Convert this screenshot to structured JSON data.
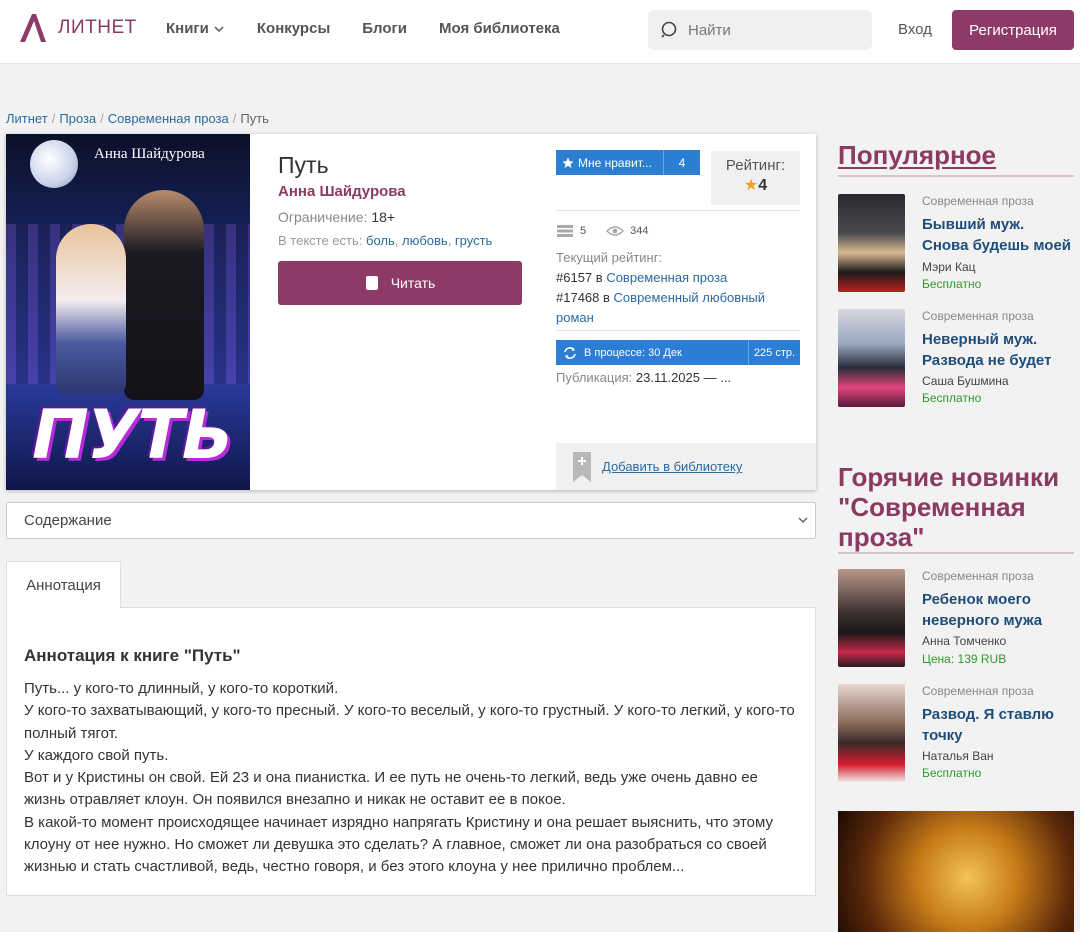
{
  "header": {
    "logo_text": "ЛИТНЕТ",
    "nav": [
      "Книги",
      "Конкурсы",
      "Блоги",
      "Моя библиотека"
    ],
    "search_placeholder": "Найти",
    "login": "Вход",
    "register": "Регистрация"
  },
  "breadcrumb": [
    "Литнет",
    "Проза",
    "Современная проза",
    "Путь"
  ],
  "book": {
    "cover_author": "Анна Шайдурова",
    "cover_title": "ПУТЬ",
    "title": "Путь",
    "author": "Анна Шайдурова",
    "restriction_label": "Ограничение:",
    "restriction_value": "18+",
    "tags_label": "В тексте есть:",
    "tags": [
      "боль",
      "любовь",
      "грусть"
    ],
    "read_button": "Читать",
    "like_label": "Мне нравит...",
    "like_count": "4",
    "rating_label": "Рейтинг:",
    "rating_value": "4",
    "library_count": "5",
    "views_count": "344",
    "current_rating_label": "Текущий рейтинг:",
    "rank1_num": "#6157",
    "rank1_genre": "Современная проза",
    "rank2_num": "#17468",
    "rank2_genre": "Современный любовный роман",
    "in_word": "в",
    "status": "В процессе: 30 Дек",
    "pages": "225 стр.",
    "publication_label": "Публикация:",
    "publication_value": "23.11.2025 — ...",
    "add_library": "Добавить в библиотеку"
  },
  "contents_label": "Содержание",
  "tab_label": "Аннотация",
  "annotation": {
    "title": "Аннотация к книге \"Путь\"",
    "lines": [
      "Путь... у кого-то длинный, у кого-то короткий.",
      "У кого-то захватывающий, у кого-то пресный. У кого-то веселый, у кого-то грустный. У кого-то легкий, у кого-то полный тягот.",
      "У каждого свой путь.",
      "Вот и у Кристины он свой. Ей 23 и она пианистка. И ее путь не очень-то легкий, ведь уже очень давно ее жизнь отравляет клоун. Он появился внезапно и никак не оставит ее в покое.",
      "В какой-то момент происходящее начинает изрядно напрягать Кристину и она решает выяснить, что этому клоуну от нее нужно. Но сможет ли девушка это сделать? А главное, сможет ли она разобраться со своей жизнью и стать счастливой, ведь, честно говоря, и без этого клоуна у нее прилично проблем..."
    ]
  },
  "popular": {
    "title": "Популярное",
    "items": [
      {
        "genre": "Современная проза",
        "title": "Бывший муж. Снова будешь моей",
        "author": "Мэри Кац",
        "price": "Бесплатно"
      },
      {
        "genre": "Современная проза",
        "title": "Неверный муж. Развода не будет",
        "author": "Саша Бушмина",
        "price": "Бесплатно"
      }
    ]
  },
  "hot": {
    "title": "Горячие новинки \"Современная проза\"",
    "items": [
      {
        "genre": "Современная проза",
        "title": "Ребенок моего неверного мужа",
        "author": "Анна Томченко",
        "price": "Цена: 139 RUB"
      },
      {
        "genre": "Современная проза",
        "title": "Развод. Я ставлю точку",
        "author": "Наталья Ван",
        "price": "Бесплатно"
      }
    ]
  },
  "colors": {
    "brand": "#8e3a66",
    "link": "#2b6aa0",
    "blue": "#2c7dd4",
    "free": "#2e9a2e"
  }
}
